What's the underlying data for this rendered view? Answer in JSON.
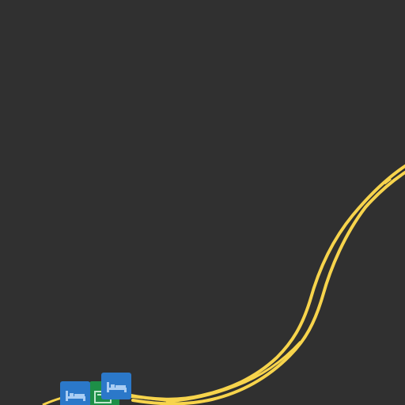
{
  "map": {
    "background_color": "#303030",
    "road_color": "#f7d44c",
    "road_casing_color": "#e0b93a",
    "road_type": "motorway",
    "pois": [
      {
        "id": "hotel-1",
        "icon": "bed-icon",
        "category": "hotel",
        "color": "#2b78c9"
      },
      {
        "id": "hotel-2",
        "icon": "bed-icon",
        "category": "hotel",
        "color": "#2b78c9"
      },
      {
        "id": "green-poi",
        "icon": "ticket-icon",
        "category": "attraction",
        "color": "#1d8f47"
      }
    ]
  }
}
